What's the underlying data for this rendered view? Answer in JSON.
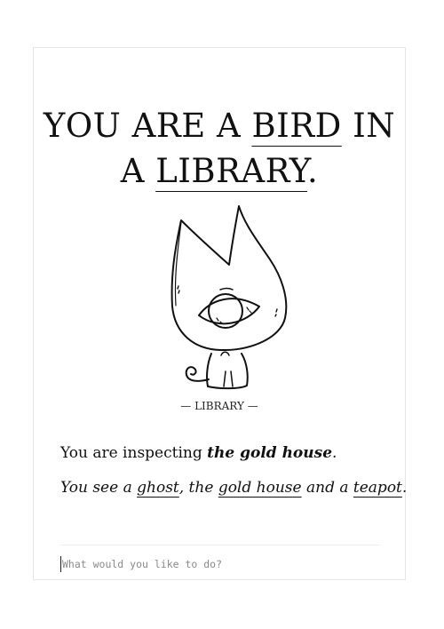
{
  "title": {
    "prefix": "YOU ARE A ",
    "creature": "BIRD",
    "middle": " IN",
    "a": "A ",
    "location": "LIBRARY",
    "period": "."
  },
  "image": {
    "icon": "one-eyed-cat-creature"
  },
  "caption": "— LIBRARY —",
  "inspect": {
    "prefix": "You are inspecting ",
    "target": "the gold house",
    "suffix": "."
  },
  "see": {
    "prefix": "You see a ",
    "item1": "ghost",
    "sep1": ", the ",
    "item2": "gold house",
    "sep2": " and a ",
    "item3": "teapot",
    "suffix": "."
  },
  "command": {
    "placeholder": "What would you like to do?",
    "value": ""
  }
}
